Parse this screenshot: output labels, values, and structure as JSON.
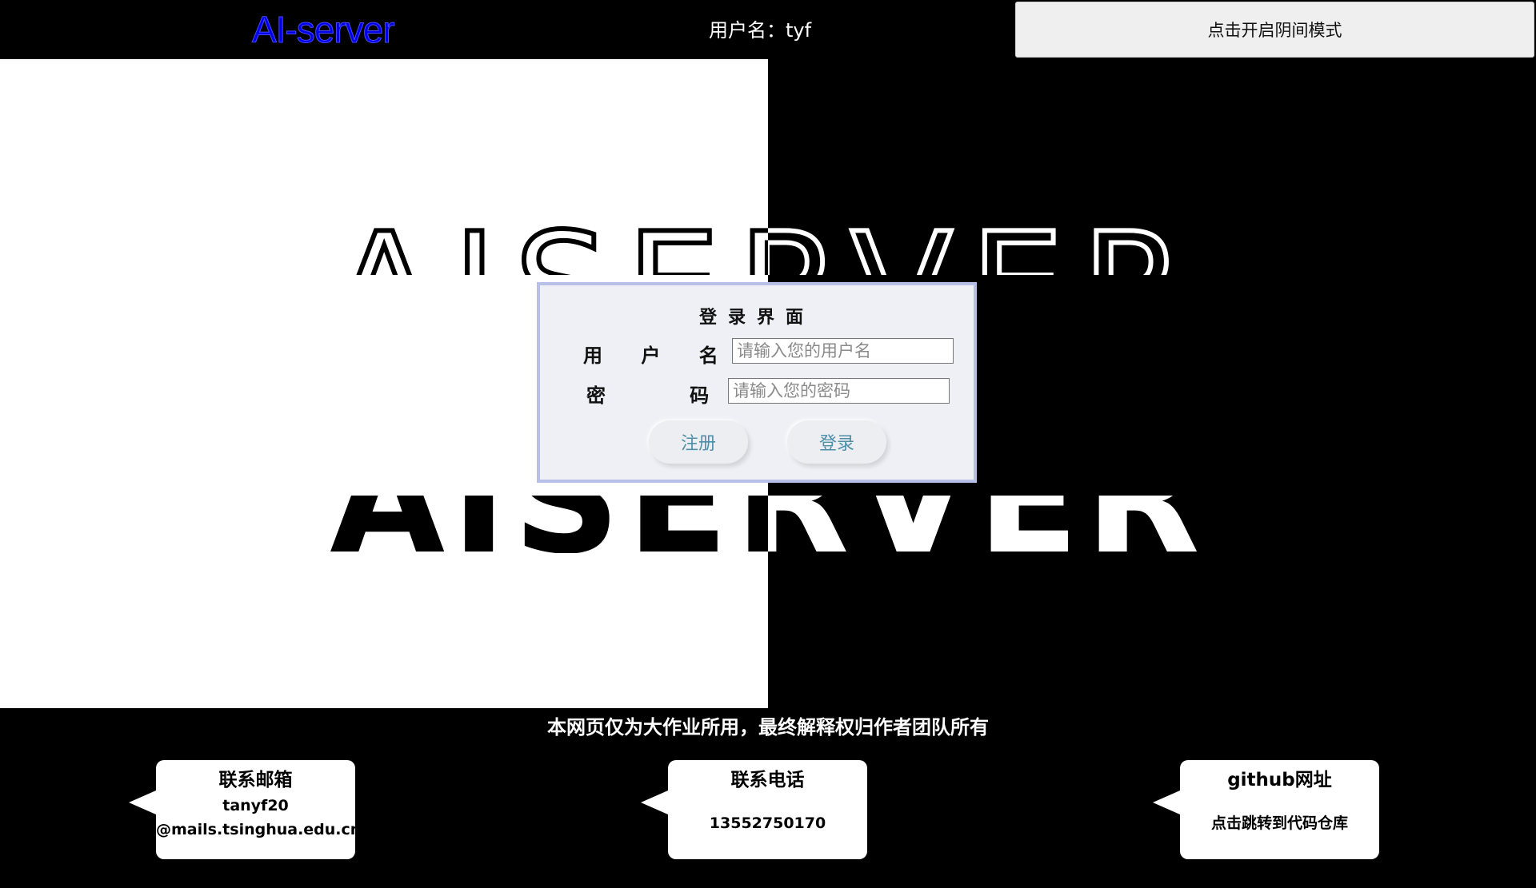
{
  "header": {
    "brand": "AI-server",
    "user_label": "用户名：tyf",
    "dark_mode_button": "点击开启阴间模式"
  },
  "background": {
    "big_text": "AISERVER"
  },
  "login": {
    "title": "登录界面",
    "username_label": "用 户 名 ：",
    "username_placeholder": "请输入您的用户名",
    "password_label": "密   码 ：",
    "password_placeholder": "请输入您的密码",
    "register_label": "注册",
    "login_label": "登录"
  },
  "footer": {
    "disclaimer": "本网页仅为大作业所用，最终解释权归作者团队所有",
    "cards": [
      {
        "title": "联系邮箱",
        "line1": "tanyf20",
        "line2": "@mails.tsinghua.edu.cn"
      },
      {
        "title": "联系电话",
        "line1": "13552750170"
      },
      {
        "title": "github网址",
        "line1": "点击跳转到代码仓库"
      }
    ]
  },
  "colors": {
    "brand": "#0000e8",
    "panel_border": "#b8c0e8",
    "button_text": "#4e8fa8"
  }
}
